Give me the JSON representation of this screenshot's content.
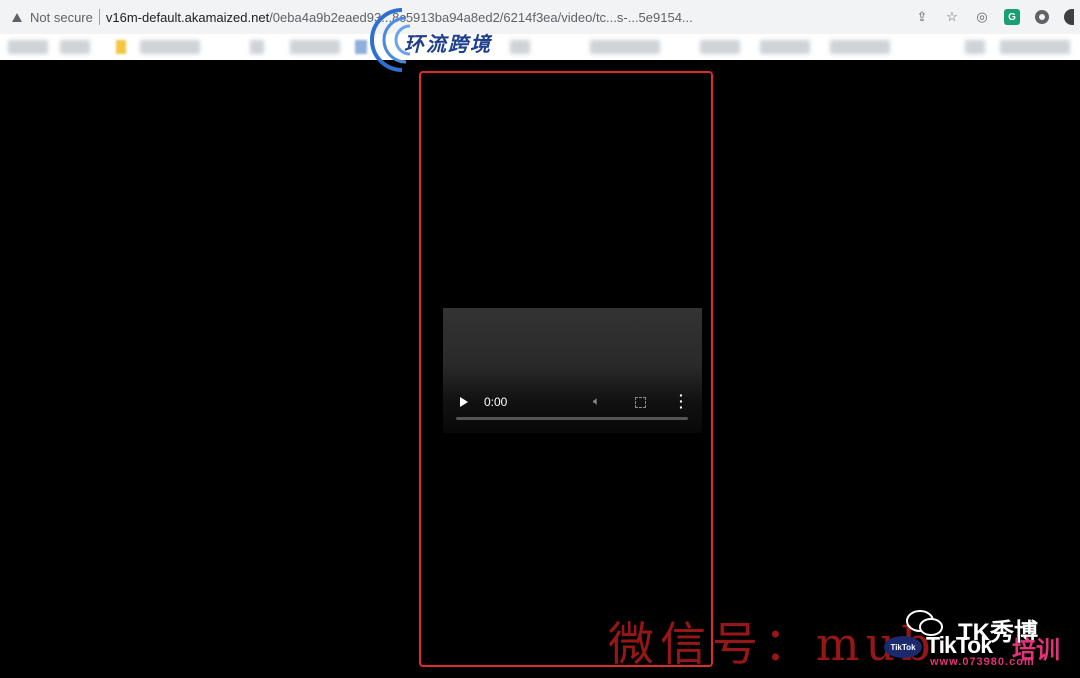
{
  "browser": {
    "security_label": "Not secure",
    "url_host": "v16m-default.akamaized.net",
    "url_path": "/0eba4a9b2eaed93...8c5913ba94a8ed2/6214f3ea/video/tc...s-...5e9154...",
    "icons": [
      "share-icon",
      "star-icon",
      "extension-icon",
      "grammarly-icon",
      "circle-extension-icon"
    ]
  },
  "logo": {
    "text": "环流跨境"
  },
  "video": {
    "time": "0:00"
  },
  "watermarks": {
    "wechat_line": "微信号：mub",
    "tk_label": "TK秀博",
    "badge": "TikTok",
    "tiktok": "TikTok",
    "train": "培训",
    "site": "www.073980.com"
  },
  "colors": {
    "highlight": "#e02b2b",
    "background": "#000000",
    "chrome": "#f1f3f4"
  }
}
